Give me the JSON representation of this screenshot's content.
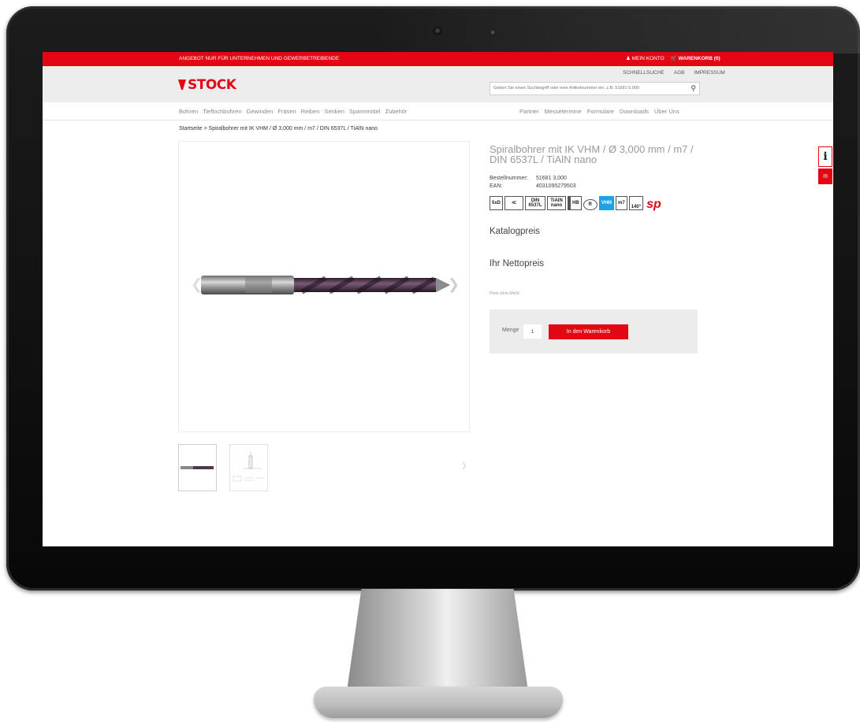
{
  "topbar": {
    "notice": "ANGEBOT NUR FÜR UNTERNEHMEN UND GEWERBETREIBENDE",
    "account": "MEIN KONTO",
    "cart": "WARENKORB (0)"
  },
  "header": {
    "logo": "STOCK",
    "links": [
      "SCHNELLSUCHE",
      "AGB",
      "IMPRESSUM"
    ],
    "search_placeholder": "Geben Sie einen Suchbegriff oder eine Artikelnummer ein, z.B. 51681 5,000"
  },
  "nav": {
    "left": [
      "Bohren",
      "Tieflochbohren",
      "Gewinden",
      "Fräsen",
      "Reiben",
      "Senken",
      "Spannmittel",
      "Zubehör"
    ],
    "right": [
      "Partner",
      "Messetermine",
      "Formulare",
      "Downloads",
      "Über Uns"
    ]
  },
  "breadcrumb": "Startseite > Spiralbohrer mit IK VHM / Ø 3,000 mm / m7 / DIN 6537L / TiAlN nano",
  "product": {
    "title": "Spiralbohrer mit IK VHM / Ø 3,000 mm / m7 / DIN 6537L / TiAlN nano",
    "order_label": "Bestellnummer:",
    "order_value": "51681 3,000",
    "ean_label": "EAN:",
    "ean_value": "4031095279503",
    "badges": [
      "5xD",
      "DIN 6537L",
      "TiAlN nano",
      "HB",
      "R",
      "VHM",
      "m7",
      "140°"
    ],
    "sp_mark": "sp",
    "catalog_price_label": "Katalogpreis",
    "net_price_label": "Ihr Nettopreis",
    "vat_note": "Preis ohne MwSt.",
    "qty_label": "Menge",
    "qty_value": "1",
    "add_to_cart": "In den Warenkorb"
  },
  "side": {
    "info_icon": "info-icon",
    "second_icon": "share-icon"
  },
  "colors": {
    "brand_red": "#e30613",
    "vhm_blue": "#1aa3e8"
  }
}
